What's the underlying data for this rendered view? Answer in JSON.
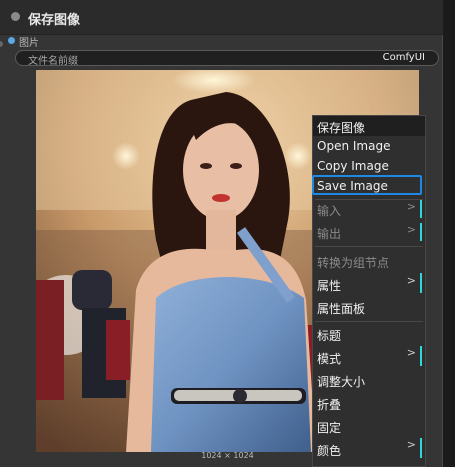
{
  "node": {
    "title": "保存图像",
    "input_label": "图片",
    "widget_label": "文件名前缀",
    "widget_value": "ComfyUI",
    "image_dimensions": "1024 × 1024"
  },
  "menu": {
    "title": "保存图像",
    "items": [
      {
        "label": "Open Image",
        "disabled": false
      },
      {
        "label": "Copy Image",
        "disabled": false
      },
      {
        "label": "Save Image",
        "disabled": false,
        "highlighted": true
      },
      {
        "label": "输入",
        "disabled": true,
        "submenu": true
      },
      {
        "label": "输出",
        "disabled": true,
        "submenu": true
      },
      {
        "label": "转换为组节点",
        "disabled": true
      },
      {
        "label": "属性",
        "disabled": false,
        "submenu": true
      },
      {
        "label": "属性面板",
        "disabled": false
      },
      {
        "label": "标题",
        "disabled": false
      },
      {
        "label": "模式",
        "disabled": false,
        "submenu": true
      },
      {
        "label": "调整大小",
        "disabled": false
      },
      {
        "label": "折叠",
        "disabled": false
      },
      {
        "label": "固定",
        "disabled": false
      },
      {
        "label": "颜色",
        "disabled": false,
        "submenu": true
      }
    ],
    "submenu_arrow": ">"
  },
  "colors": {
    "accent": "#1e88e5",
    "submenu_bar": "#2fd8d8",
    "slot": "#5aa8e8"
  },
  "icons": {
    "node_status": "circle-dot-icon",
    "submenu": "chevron-right-icon"
  }
}
